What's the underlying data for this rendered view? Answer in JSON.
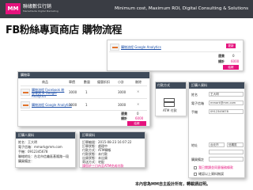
{
  "header": {
    "logo_mark": "MM",
    "logo_name": "聯緣數位行銷",
    "logo_subname": "MarkeMedia Digital Marketing",
    "tagline": "Minimum cost, Maximum ROI, Digital Consulting & Solutions"
  },
  "page_title": "FB粉絲專頁商店 購物流程",
  "back_cart": {
    "item_name": "購物流程 Google Analytics",
    "update_button": "更新",
    "rows": [
      {
        "label": "運費",
        "value": "0"
      },
      {
        "label": "總計",
        "value": "6000"
      }
    ],
    "primary_button": "結帳"
  },
  "steps": {
    "step2_title": "付款方式",
    "step3_title": "訂購人資料",
    "payment_label": "ATM 付款"
  },
  "front_cart": {
    "title": "購物車",
    "headers": [
      "商品",
      "單價",
      "數量",
      "優惠折扣",
      "小計",
      "刪除"
    ],
    "items": [
      {
        "name": "購物流程 Facebook 粉絲專頁 & Google Analytics",
        "price": "3000",
        "qty": "1",
        "subtotal": "3000"
      },
      {
        "name": "購物流程 Google Analytics",
        "price": "3000",
        "qty": "1",
        "subtotal": "3000"
      }
    ],
    "totals": [
      {
        "label": "運費",
        "value": "0"
      },
      {
        "label": "總計",
        "value": "6000"
      }
    ],
    "checkout_button": "結帳"
  },
  "customer_box": {
    "title": "訂購人資料",
    "lines": [
      "姓名：王大明",
      "電子信箱：mmark@mm.com",
      "手機：0912345678",
      "聯絡地址：台北市信義區基隆路一段",
      "購買備註："
    ]
  },
  "order_box": {
    "title": "訂單資料",
    "lines": [
      "訂單編號：2015-08-23 16:07:22",
      "訂單狀態：處理中",
      "付款方式：ATM轉帳",
      "付款狀態：未付款",
      "出貨狀態：未出貨",
      "寄送方式：宅配"
    ],
    "note": "請您於三日內至ATM完成付款"
  },
  "form": {
    "title": "訂購人資料",
    "fields": [
      {
        "label": "姓名",
        "value": "王大明"
      },
      {
        "label": "電子信箱",
        "value": "mmark@mm.com"
      },
      {
        "label": "手機",
        "value": "0912345678"
      }
    ],
    "address_label": "地址",
    "city": "台北市",
    "district": "信義區",
    "note_label": "購買備註",
    "agree_text": "我已閱讀並同意服務條款",
    "confirm_text": "確認以上資料無誤"
  },
  "footer": "本內容為MM自主設計所有，轉載請註明。"
}
